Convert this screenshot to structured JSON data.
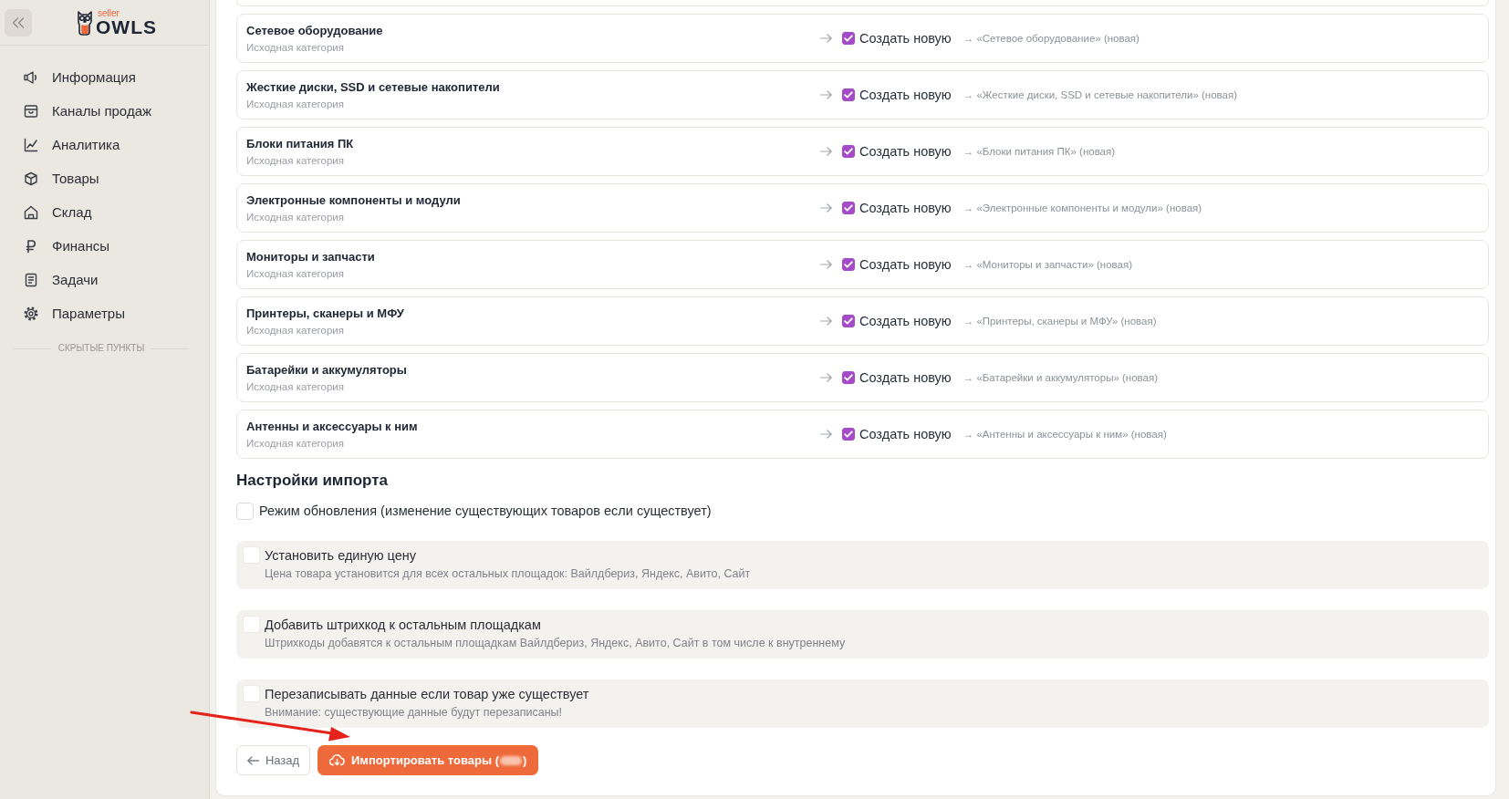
{
  "sidebar": {
    "logo": {
      "tagline": "seller",
      "wordmark": "OWLS"
    },
    "items": [
      {
        "label": "Информация",
        "kind": "megaphone",
        "selected": false
      },
      {
        "label": "Каналы продаж",
        "kind": "store",
        "selected": false
      },
      {
        "label": "Аналитика",
        "kind": "chart",
        "selected": false
      },
      {
        "label": "Товары",
        "kind": "cube",
        "selected": false
      },
      {
        "label": "Склад",
        "kind": "house",
        "selected": false
      },
      {
        "label": "Финансы",
        "kind": "ruble",
        "selected": false
      },
      {
        "label": "Задачи",
        "kind": "document",
        "selected": false
      },
      {
        "label": "Параметры",
        "kind": "gear",
        "selected": false
      }
    ],
    "hidden_section_label": "СКРЫТЫЕ ПУНКТЫ"
  },
  "category_mappings": [
    {
      "source": "Сетевое оборудование",
      "caption": "Исходная категория",
      "create_new": true,
      "create_label": "Создать новую",
      "target": "→ «Сетевое оборудование» (новая)"
    },
    {
      "source": "Жесткие диски, SSD и сетевые накопители",
      "caption": "Исходная категория",
      "create_new": true,
      "create_label": "Создать новую",
      "target": "→ «Жесткие диски, SSD и сетевые накопители» (новая)"
    },
    {
      "source": "Блоки питания ПК",
      "caption": "Исходная категория",
      "create_new": true,
      "create_label": "Создать новую",
      "target": "→ «Блоки питания ПК» (новая)"
    },
    {
      "source": "Электронные компоненты и модули",
      "caption": "Исходная категория",
      "create_new": true,
      "create_label": "Создать новую",
      "target": "→ «Электронные компоненты и модули» (новая)"
    },
    {
      "source": "Мониторы и запчасти",
      "caption": "Исходная категория",
      "create_new": true,
      "create_label": "Создать новую",
      "target": "→ «Мониторы и запчасти» (новая)"
    },
    {
      "source": "Принтеры, сканеры и МФУ",
      "caption": "Исходная категория",
      "create_new": true,
      "create_label": "Создать новую",
      "target": "→ «Принтеры, сканеры и МФУ» (новая)"
    },
    {
      "source": "Батарейки и аккумуляторы",
      "caption": "Исходная категория",
      "create_new": true,
      "create_label": "Создать новую",
      "target": "→ «Батарейки и аккумуляторы» (новая)"
    },
    {
      "source": "Антенны и аксессуары к ним",
      "caption": "Исходная категория",
      "create_new": true,
      "create_label": "Создать новую",
      "target": "→ «Антенны и аксессуары к ним» (новая)"
    }
  ],
  "import_settings": {
    "title": "Настройки импорта",
    "update_mode": {
      "label": "Режим обновления (изменение существующих товаров если существует)",
      "checked": false
    },
    "options": [
      {
        "label": "Установить единую цену",
        "description": "Цена товара установится для всех остальных площадок: Вайлдбериз, Яндекс, Авито, Сайт",
        "checked": false
      },
      {
        "label": "Добавить штрихкод к остальным площадкам",
        "description": "Штрихкоды добавятся к остальным площадкам Вайлдбериз, Яндекс, Авито, Сайт в том числе к внутреннему",
        "checked": false
      },
      {
        "label": "Перезаписывать данные если товар уже существует",
        "description": "Внимание: существующие данные будут перезаписаны!",
        "checked": false
      }
    ]
  },
  "buttons": {
    "back": "Назад",
    "import": {
      "label": "Импортировать товары (",
      "count_blurred": true,
      "label_end": ")"
    }
  }
}
